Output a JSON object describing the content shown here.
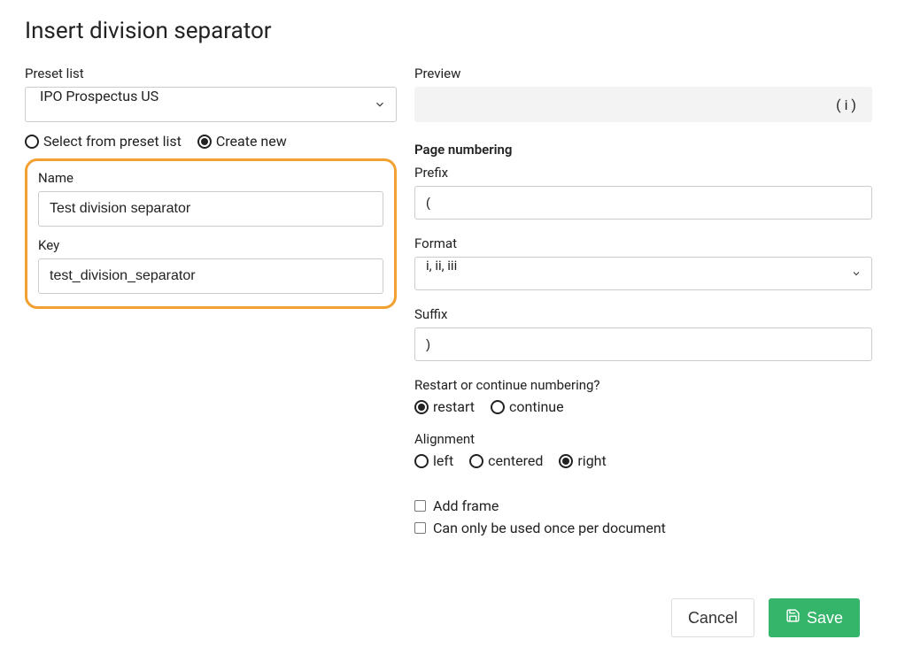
{
  "title": "Insert division separator",
  "left": {
    "preset_label": "Preset list",
    "preset_value": "IPO Prospectus US",
    "radio_select_label": "Select from preset list",
    "radio_create_label": "Create new",
    "name_label": "Name",
    "name_value": "Test division separator",
    "key_label": "Key",
    "key_value": "test_division_separator"
  },
  "right": {
    "preview_label": "Preview",
    "preview_value": "( i )",
    "page_numbering_label": "Page numbering",
    "prefix_label": "Prefix",
    "prefix_value": "(",
    "format_label": "Format",
    "format_value": "i, ii, iii",
    "suffix_label": "Suffix",
    "suffix_value": ")",
    "restart_label": "Restart or continue numbering?",
    "radio_restart": "restart",
    "radio_continue": "continue",
    "alignment_label": "Alignment",
    "align_left": "left",
    "align_centered": "centered",
    "align_right": "right",
    "add_frame": "Add frame",
    "use_once": "Can only be used once per document"
  },
  "footer": {
    "cancel": "Cancel",
    "save": "Save"
  }
}
